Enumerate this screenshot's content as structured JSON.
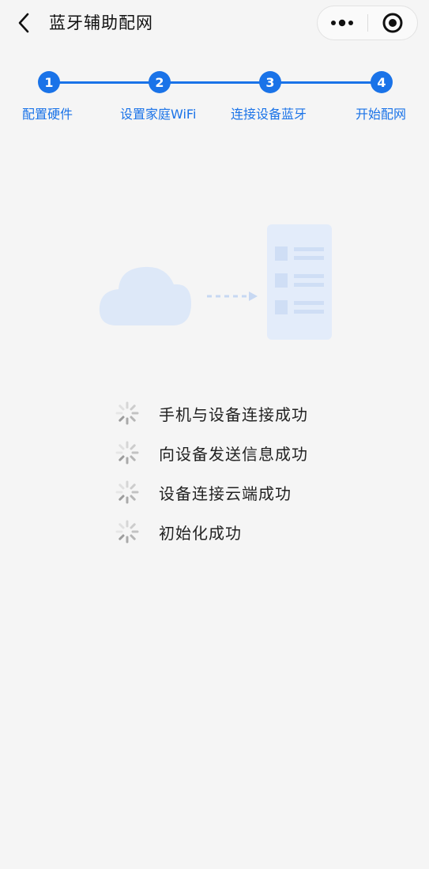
{
  "nav": {
    "title": "蓝牙辅助配网",
    "back_icon": "chevron-left-icon",
    "more_icon": "more-dots-icon",
    "target_icon": "target-circle-icon"
  },
  "steps": [
    {
      "number": "1",
      "label": "配置硬件"
    },
    {
      "number": "2",
      "label": "设置家庭WiFi"
    },
    {
      "number": "3",
      "label": "连接设备蓝牙"
    },
    {
      "number": "4",
      "label": "开始配网"
    }
  ],
  "status": [
    {
      "text": "手机与设备连接成功"
    },
    {
      "text": "向设备发送信息成功"
    },
    {
      "text": "设备连接云端成功"
    },
    {
      "text": "初始化成功"
    }
  ],
  "colors": {
    "accent": "#1a73e8",
    "background": "#f5f5f5",
    "illustration": "#dbe7f8"
  }
}
